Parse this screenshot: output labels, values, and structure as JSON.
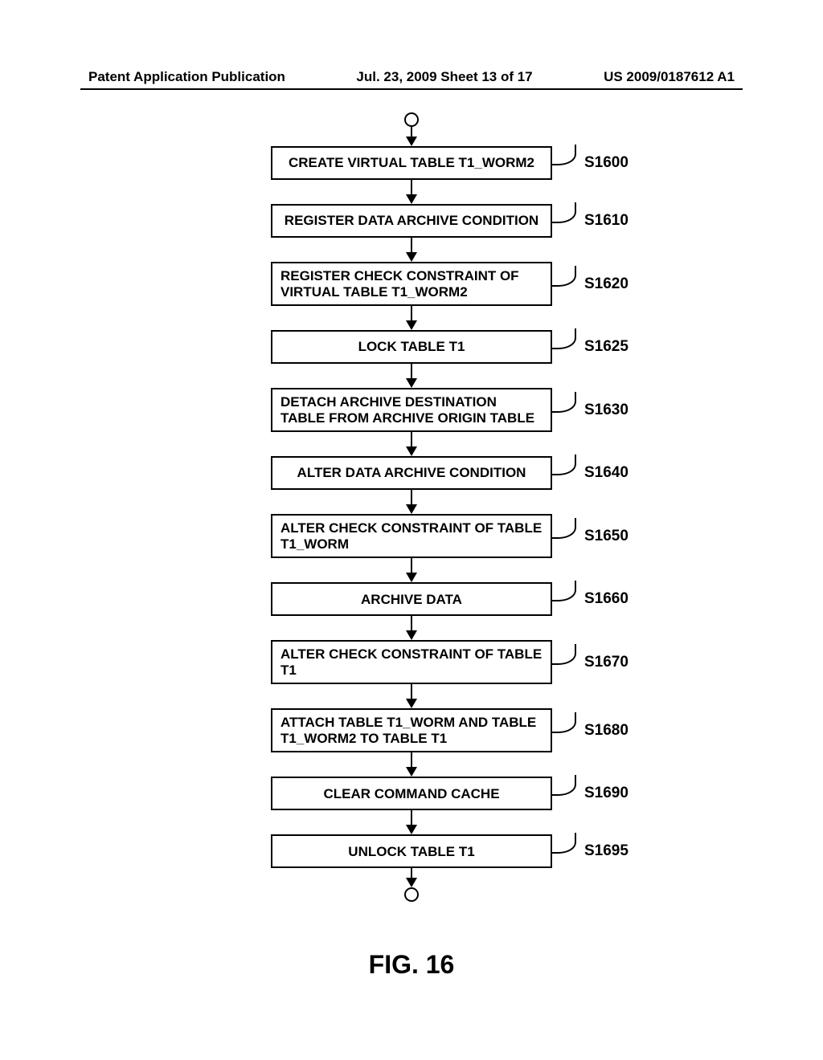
{
  "header": {
    "left": "Patent Application Publication",
    "center": "Jul. 23, 2009  Sheet 13 of 17",
    "right": "US 2009/0187612 A1"
  },
  "figure_caption": "FIG. 16",
  "chart_data": {
    "type": "flowchart",
    "title": "FIG. 16",
    "direction": "top-to-bottom",
    "start": "terminator",
    "end": "terminator",
    "steps": [
      {
        "id": "S1600",
        "text": "CREATE VIRTUAL TABLE T1_WORM2",
        "align": "center"
      },
      {
        "id": "S1610",
        "text": "REGISTER DATA ARCHIVE CONDITION",
        "align": "center"
      },
      {
        "id": "S1620",
        "text": "REGISTER CHECK CONSTRAINT OF VIRTUAL TABLE T1_WORM2",
        "align": "left"
      },
      {
        "id": "S1625",
        "text": "LOCK TABLE T1",
        "align": "center"
      },
      {
        "id": "S1630",
        "text": "DETACH ARCHIVE DESTINATION TABLE FROM ARCHIVE ORIGIN TABLE",
        "align": "left"
      },
      {
        "id": "S1640",
        "text": "ALTER DATA ARCHIVE CONDITION",
        "align": "center"
      },
      {
        "id": "S1650",
        "text": "ALTER CHECK CONSTRAINT OF TABLE T1_WORM",
        "align": "left"
      },
      {
        "id": "S1660",
        "text": "ARCHIVE DATA",
        "align": "center"
      },
      {
        "id": "S1670",
        "text": "ALTER CHECK CONSTRAINT OF TABLE T1",
        "align": "left"
      },
      {
        "id": "S1680",
        "text": "ATTACH TABLE T1_WORM AND TABLE T1_WORM2 TO TABLE T1",
        "align": "left"
      },
      {
        "id": "S1690",
        "text": "CLEAR COMMAND CACHE",
        "align": "center"
      },
      {
        "id": "S1695",
        "text": "UNLOCK TABLE T1",
        "align": "center"
      }
    ]
  }
}
